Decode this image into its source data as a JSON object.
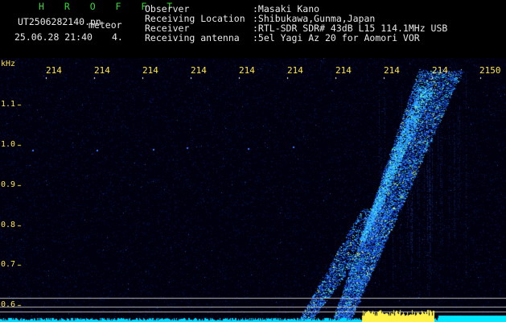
{
  "header": {
    "app_name": "H R O F F T",
    "filename": "UT2506282140.pn",
    "mode": "meteor",
    "datetime": "25.06.28 21:40",
    "count": "4.",
    "fields": [
      {
        "label": "Observer",
        "value": ":Masaki Kano"
      },
      {
        "label": "Receiving Location",
        "value": ":Shibukawa,Gunma,Japan"
      },
      {
        "label": "Receiver",
        "value": ":RTL-SDR SDR# 43dB L15 114.1MHz USB"
      },
      {
        "label": "Receiving antenna",
        "value": ":5el Yagi Az 20 for Aomori VOR"
      }
    ]
  },
  "plot": {
    "y_unit": "kHz",
    "y_ticks": [
      "1.1",
      "1.0",
      "0.9",
      "0.8",
      "0.7",
      "0.6"
    ],
    "x_ticks": [
      "214",
      "214",
      "214",
      "214",
      "214",
      "214",
      "214",
      "214",
      "214",
      "2150"
    ],
    "colors": {
      "background": "#000010",
      "signal": "#3aa0ff",
      "peak": "#ffee00",
      "baseline": "#00e5ff"
    }
  }
}
